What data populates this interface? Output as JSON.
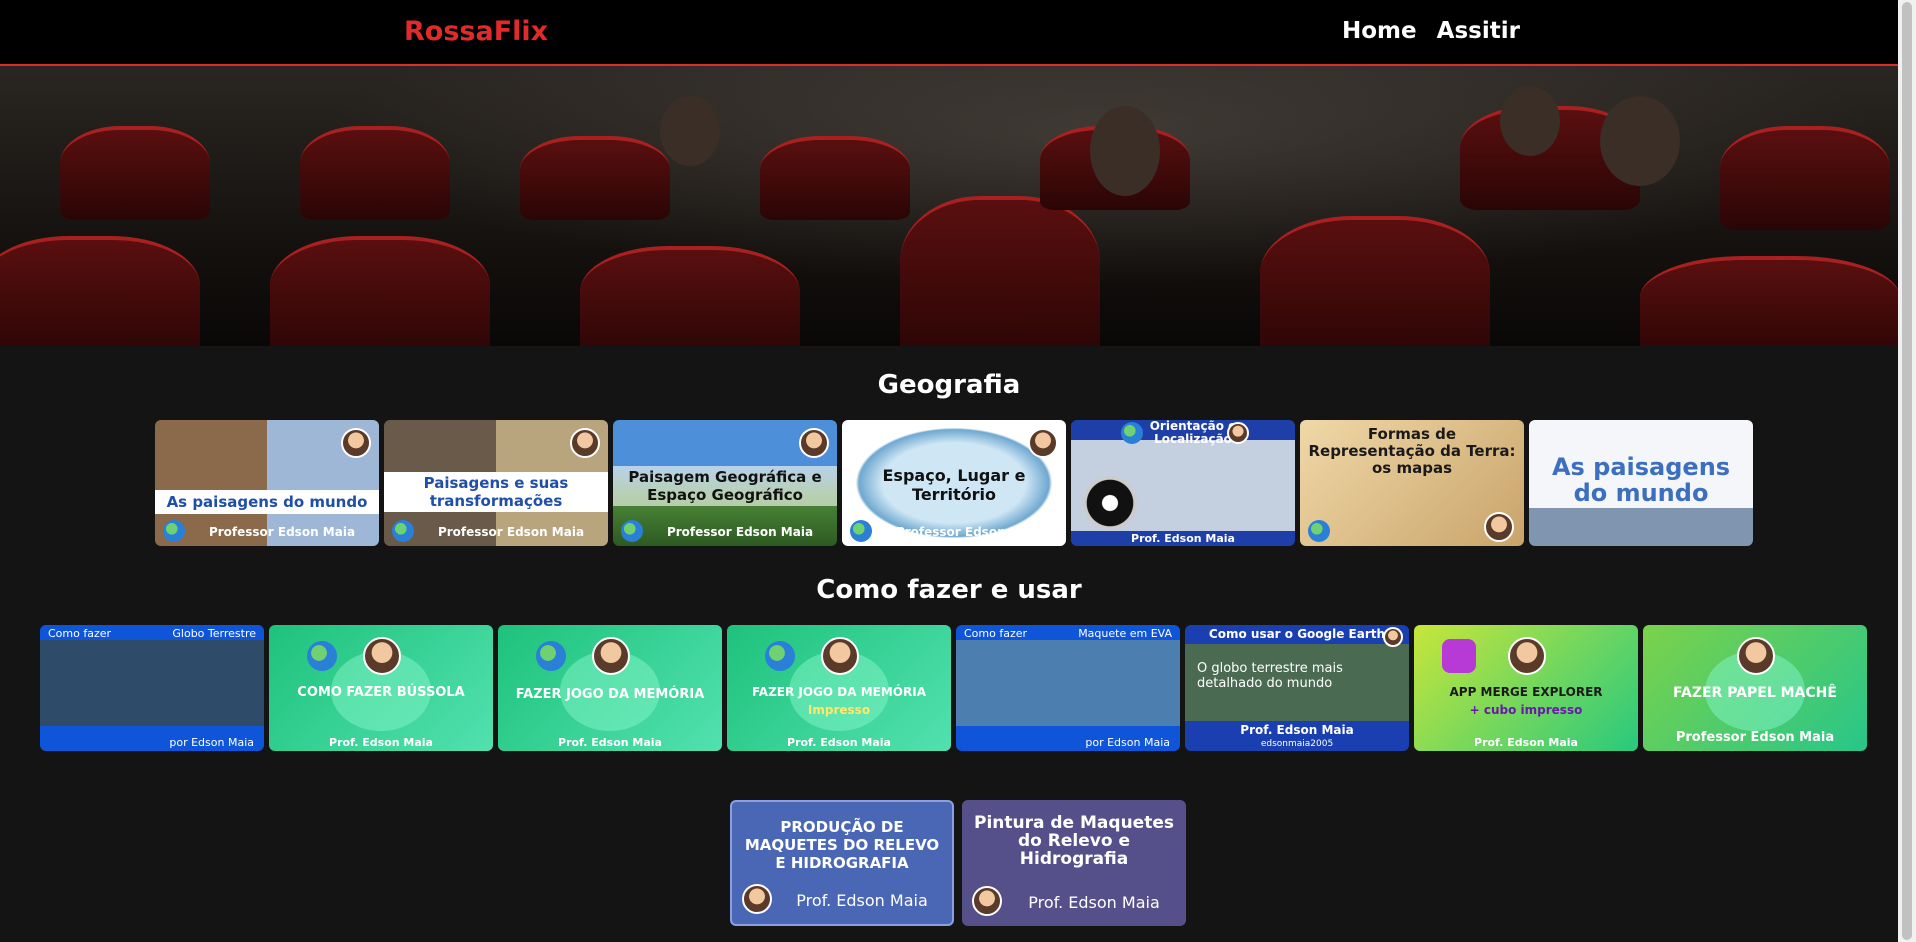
{
  "header": {
    "logo": "RossaFlix",
    "nav": [
      "Home",
      "Assitir"
    ]
  },
  "sections": [
    {
      "title": "Geografia",
      "cards": [
        {
          "caption": "As paisagens do mundo",
          "author": "Professor Edson Maia"
        },
        {
          "caption": "Paisagens e suas transformações",
          "author": "Professor Edson Maia"
        },
        {
          "caption": "Paisagem Geográfica e Espaço Geográfico",
          "author": "Professor Edson Maia"
        },
        {
          "caption": "Espaço, Lugar e Território",
          "author": "Professor Edson Maia"
        },
        {
          "caption": "Orientação e Localização",
          "author": "Prof. Edson Maia"
        },
        {
          "caption": "Formas de Representação da Terra: os mapas",
          "author": ""
        },
        {
          "caption": "As paisagens do mundo",
          "author": ""
        }
      ]
    },
    {
      "title": "Como fazer e usar",
      "cards": [
        {
          "caption_left": "Como fazer",
          "caption_right": "Globo Terrestre",
          "author": "por Edson Maia"
        },
        {
          "caption": "COMO FAZER BÚSSOLA",
          "author": "Prof. Edson Maia"
        },
        {
          "caption": "FAZER JOGO DA MEMÓRIA",
          "author": "Prof. Edson Maia"
        },
        {
          "caption": "FAZER JOGO DA MEMÓRIA",
          "sub": "Impresso",
          "author": "Prof. Edson Maia"
        },
        {
          "caption_left": "Como fazer",
          "caption_right": "Maquete em EVA",
          "author": "por Edson Maia"
        },
        {
          "caption": "Como usar o Google Earth",
          "sub": "O globo terrestre mais detalhado do mundo",
          "author": "Prof. Edson Maia",
          "extra": "edsonmaia2005"
        },
        {
          "caption": "APP MERGE EXPLORER",
          "sub": "+ cubo impresso",
          "author": "Prof. Edson Maia"
        },
        {
          "caption": "FAZER PAPEL MACHÊ",
          "author": "Professor Edson Maia"
        }
      ]
    },
    {
      "cards": [
        {
          "caption": "PRODUÇÃO DE MAQUETES DO RELEVO E HIDROGRAFIA",
          "author": "Prof. Edson Maia"
        },
        {
          "caption": "Pintura de Maquetes do Relevo e Hidrografia",
          "author": "Prof. Edson Maia"
        }
      ]
    }
  ]
}
